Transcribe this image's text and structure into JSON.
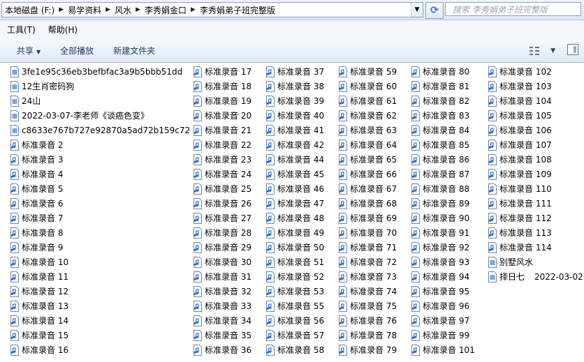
{
  "address": {
    "crumbs": [
      "本地磁盘 (F:)",
      "易学资料",
      "风水",
      "李秀娟金口",
      "李秀娟弟子班完整版"
    ],
    "search_placeholder": "搜索 李秀娟弟子班完整版"
  },
  "menu": [
    "工具(T)",
    "帮助(H)"
  ],
  "toolbar": {
    "share": "共享",
    "play_all": "全部播放",
    "new_folder": "新建文件夹"
  },
  "files": {
    "col1": [
      {
        "name": "3fe1e95c36eb3befbfac3a9b5bbb51dd",
        "icon": "document-icon"
      },
      {
        "name": "12生肖密码狗",
        "icon": "document-icon"
      },
      {
        "name": "24山",
        "icon": "document-icon"
      },
      {
        "name": "2022-03-07-李老师《谈癌色变》",
        "icon": "document-icon"
      },
      {
        "name": "c8633e767b727e92870a5ad72b159c72",
        "icon": "document-icon"
      },
      {
        "name": "标准录音 2",
        "icon": "audio-file-icon"
      },
      {
        "name": "标准录音 3",
        "icon": "audio-file-icon"
      },
      {
        "name": "标准录音 4",
        "icon": "audio-file-icon"
      },
      {
        "name": "标准录音 5",
        "icon": "audio-file-icon"
      },
      {
        "name": "标准录音 6",
        "icon": "audio-file-icon"
      },
      {
        "name": "标准录音 7",
        "icon": "audio-file-icon"
      },
      {
        "name": "标准录音 8",
        "icon": "audio-file-icon"
      },
      {
        "name": "标准录音 9",
        "icon": "audio-file-icon"
      },
      {
        "name": "标准录音 10",
        "icon": "audio-file-icon"
      },
      {
        "name": "标准录音 11",
        "icon": "audio-file-icon"
      },
      {
        "name": "标准录音 12",
        "icon": "audio-file-icon"
      },
      {
        "name": "标准录音 13",
        "icon": "audio-file-icon"
      },
      {
        "name": "标准录音 14",
        "icon": "audio-file-icon"
      },
      {
        "name": "标准录音 15",
        "icon": "audio-file-icon"
      },
      {
        "name": "标准录音 16",
        "icon": "audio-file-icon"
      }
    ],
    "col2": [
      "标准录音 17",
      "标准录音 18",
      "标准录音 19",
      "标准录音 20",
      "标准录音 21",
      "标准录音 22",
      "标准录音 23",
      "标准录音 24",
      "标准录音 25",
      "标准录音 26",
      "标准录音 27",
      "标准录音 28",
      "标准录音 29",
      "标准录音 30",
      "标准录音 31",
      "标准录音 32",
      "标准录音 33",
      "标准录音 34",
      "标准录音 35",
      "标准录音 36"
    ],
    "col3": [
      "标准录音 37",
      "标准录音 38",
      "标准录音 39",
      "标准录音 40",
      "标准录音 41",
      "标准录音 42",
      "标准录音 44",
      "标准录音 45",
      "标准录音 46",
      "标准录音 47",
      "标准录音 48",
      "标准录音 49",
      "标准录音 50",
      "标准录音 51",
      "标准录音 52",
      "标准录音 53",
      "标准录音 55",
      "标准录音 56",
      "标准录音 57",
      "标准录音 58"
    ],
    "col4": [
      "标准录音 59",
      "标准录音 60",
      "标准录音 61",
      "标准录音 62",
      "标准录音 63",
      "标准录音 64",
      "标准录音 65",
      "标准录音 66",
      "标准录音 67",
      "标准录音 68",
      "标准录音 69",
      "标准录音 70",
      "标准录音 71",
      "标准录音 72",
      "标准录音 73",
      "标准录音 74",
      "标准录音 75",
      "标准录音 76",
      "标准录音 78",
      "标准录音 79"
    ],
    "col5": [
      "标准录音 80",
      "标准录音 81",
      "标准录音 82",
      "标准录音 83",
      "标准录音 84",
      "标准录音 85",
      "标准录音 86",
      "标准录音 87",
      "标准录音 88",
      "标准录音 89",
      "标准录音 90",
      "标准录音 91",
      "标准录音 92",
      "标准录音 93",
      "标准录音 94",
      "标准录音 95",
      "标准录音 96",
      "标准录音 97",
      "标准录音 99",
      "标准录音 101"
    ],
    "col6": [
      {
        "name": "标准录音 102",
        "icon": "audio-file-icon"
      },
      {
        "name": "标准录音 103",
        "icon": "audio-file-icon"
      },
      {
        "name": "标准录音 104",
        "icon": "audio-file-icon"
      },
      {
        "name": "标准录音 105",
        "icon": "audio-file-icon"
      },
      {
        "name": "标准录音 106",
        "icon": "audio-file-icon"
      },
      {
        "name": "标准录音 107",
        "icon": "audio-file-icon"
      },
      {
        "name": "标准录音 108",
        "icon": "audio-file-icon"
      },
      {
        "name": "标准录音 109",
        "icon": "audio-file-icon"
      },
      {
        "name": "标准录音 110",
        "icon": "audio-file-icon"
      },
      {
        "name": "标准录音 111",
        "icon": "audio-file-icon"
      },
      {
        "name": "标准录音 112",
        "icon": "audio-file-icon"
      },
      {
        "name": "标准录音 113",
        "icon": "audio-file-icon"
      },
      {
        "name": "标准录音 114",
        "icon": "audio-file-icon"
      },
      {
        "name": "别墅风水",
        "icon": "document-icon"
      },
      {
        "name": "择日七",
        "icon": "document-icon",
        "extra": "2022-03-02"
      }
    ]
  },
  "colors": {
    "icon_blue": "#2f6fc6",
    "link_text": "#1e395b"
  }
}
